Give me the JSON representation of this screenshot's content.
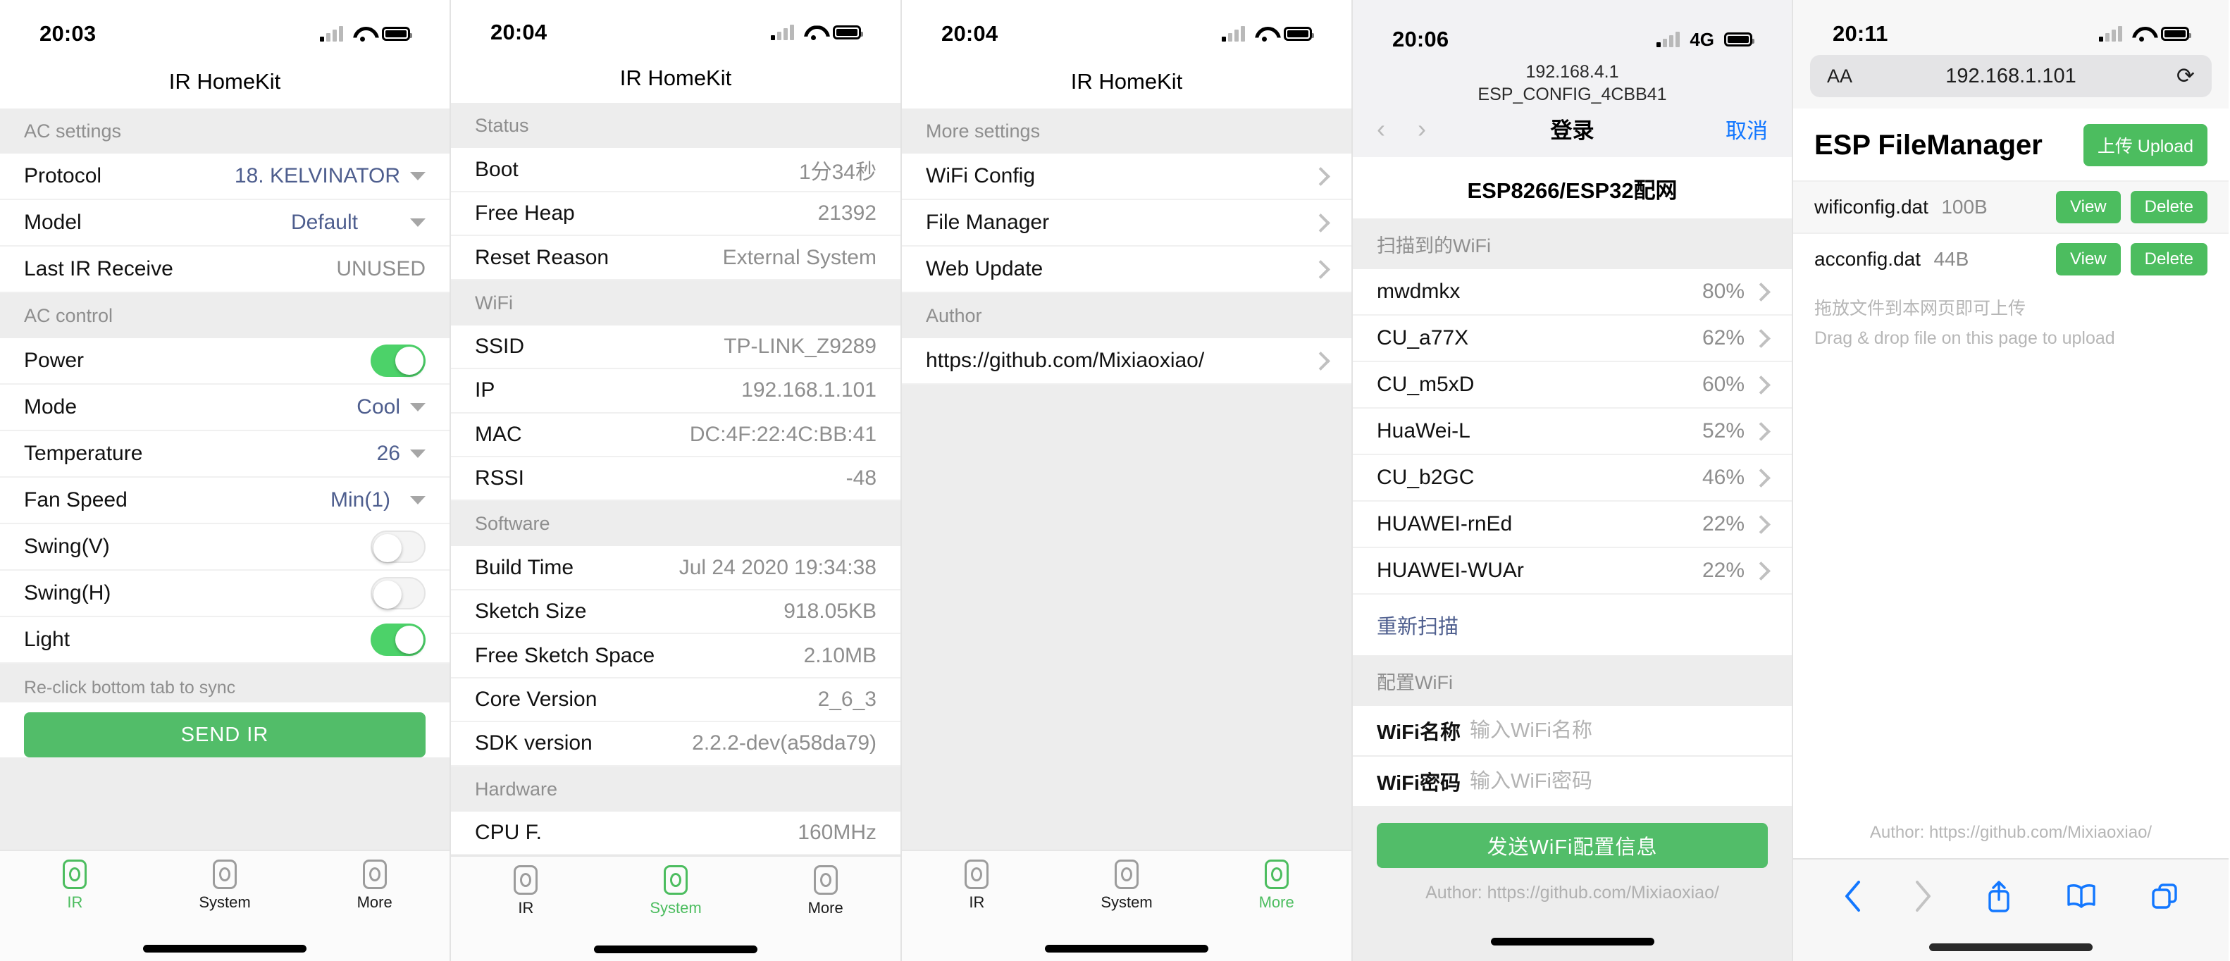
{
  "panel1": {
    "status": {
      "time": "20:03",
      "signal_icon": "cellular-bars-icon",
      "wifi_icon": "wifi-icon",
      "battery_icon": "battery-icon"
    },
    "nav_title": "IR HomeKit",
    "sections": [
      {
        "header": "AC settings",
        "rows": [
          {
            "label": "Protocol",
            "value": "18. KELVINATOR",
            "style": "blue",
            "control": "dropdown"
          },
          {
            "label": "Model",
            "value": "Default",
            "style": "blue",
            "control": "dropdown"
          },
          {
            "label": "Last IR Receive",
            "value": "UNUSED",
            "style": "gray",
            "control": "none"
          }
        ]
      },
      {
        "header": "AC control",
        "rows": [
          {
            "label": "Power",
            "value": "",
            "control": "toggle",
            "toggle_state": "on"
          },
          {
            "label": "Mode",
            "value": "Cool",
            "style": "blue",
            "control": "dropdown"
          },
          {
            "label": "Temperature",
            "value": "26",
            "style": "blue",
            "control": "dropdown"
          },
          {
            "label": "Fan Speed",
            "value": "Min(1)",
            "style": "blue",
            "control": "dropdown"
          },
          {
            "label": "Swing(V)",
            "value": "",
            "control": "toggle",
            "toggle_state": "off"
          },
          {
            "label": "Swing(H)",
            "value": "",
            "control": "toggle",
            "toggle_state": "off"
          },
          {
            "label": "Light",
            "value": "",
            "control": "toggle",
            "toggle_state": "on"
          }
        ]
      }
    ],
    "footer_note": "Re-click bottom tab to sync",
    "send_button": "SEND IR",
    "tabs": [
      {
        "label": "IR",
        "active": true
      },
      {
        "label": "System",
        "active": false
      },
      {
        "label": "More",
        "active": false
      }
    ]
  },
  "panel2": {
    "status": {
      "time": "20:04"
    },
    "nav_title": "IR HomeKit",
    "sections": [
      {
        "header": "Status",
        "rows": [
          {
            "label": "Boot",
            "value": "1分34秒"
          },
          {
            "label": "Free Heap",
            "value": "21392"
          },
          {
            "label": "Reset Reason",
            "value": "External System"
          }
        ]
      },
      {
        "header": "WiFi",
        "rows": [
          {
            "label": "SSID",
            "value": "TP-LINK_Z9289"
          },
          {
            "label": "IP",
            "value": "192.168.1.101"
          },
          {
            "label": "MAC",
            "value": "DC:4F:22:4C:BB:41"
          },
          {
            "label": "RSSI",
            "value": "-48"
          }
        ]
      },
      {
        "header": "Software",
        "rows": [
          {
            "label": "Build Time",
            "value": "Jul 24 2020 19:34:38"
          },
          {
            "label": "Sketch Size",
            "value": "918.05KB"
          },
          {
            "label": "Free Sketch Space",
            "value": "2.10MB"
          },
          {
            "label": "Core Version",
            "value": "2_6_3"
          },
          {
            "label": "SDK version",
            "value": "2.2.2-dev(a58da79)"
          }
        ]
      },
      {
        "header": "Hardware",
        "rows": [
          {
            "label": "CPU F.",
            "value": "160MHz"
          }
        ]
      }
    ],
    "tabs": [
      {
        "label": "IR",
        "active": false
      },
      {
        "label": "System",
        "active": true
      },
      {
        "label": "More",
        "active": false
      }
    ]
  },
  "panel3": {
    "status": {
      "time": "20:04"
    },
    "nav_title": "IR HomeKit",
    "sections": [
      {
        "header": "More settings",
        "rows": [
          {
            "label": "WiFi Config"
          },
          {
            "label": "File Manager"
          },
          {
            "label": "Web Update"
          }
        ]
      },
      {
        "header": "Author",
        "rows": [
          {
            "label": "https://github.com/Mixiaoxiao/"
          }
        ]
      }
    ],
    "tabs": [
      {
        "label": "IR",
        "active": false
      },
      {
        "label": "System",
        "active": false
      },
      {
        "label": "More",
        "active": true
      }
    ]
  },
  "panel4": {
    "status": {
      "time": "20:06",
      "network": "4G"
    },
    "url_line1": "192.168.4.1",
    "url_line2": "ESP_CONFIG_4CBB41",
    "back_icon": "chevron-left-icon",
    "forward_icon": "chevron-right-icon",
    "bar_title": "登录",
    "cancel": "取消",
    "page_title": "ESP8266/ESP32配网",
    "scan_header": "扫描到的WiFi",
    "networks": [
      {
        "ssid": "mwdmkx",
        "strength": "80%"
      },
      {
        "ssid": "CU_a77X",
        "strength": "62%"
      },
      {
        "ssid": "CU_m5xD",
        "strength": "60%"
      },
      {
        "ssid": "HuaWei-L",
        "strength": "52%"
      },
      {
        "ssid": "CU_b2GC",
        "strength": "46%"
      },
      {
        "ssid": "HUAWEI-rnEd",
        "strength": "22%"
      },
      {
        "ssid": "HUAWEI-WUAr",
        "strength": "22%"
      }
    ],
    "rescan": "重新扫描",
    "config_header": "配置WiFi",
    "fields": [
      {
        "label": "WiFi名称",
        "value": "",
        "placeholder": "输入WiFi名称"
      },
      {
        "label": "WiFi密码",
        "value": "",
        "placeholder": "输入WiFi密码"
      }
    ],
    "submit": "发送WiFi配置信息",
    "author": "Author: https://github.com/Mixiaoxiao/"
  },
  "panel5": {
    "status": {
      "time": "20:11"
    },
    "aa_label": "AA",
    "address": "192.168.1.101",
    "reload_icon": "reload-icon",
    "title": "ESP FileManager",
    "upload_button": "上传 Upload",
    "files": [
      {
        "name": "wificonfig.dat",
        "size": "100B",
        "view": "View",
        "delete": "Delete"
      },
      {
        "name": "acconfig.dat",
        "size": "44B",
        "view": "View",
        "delete": "Delete"
      }
    ],
    "hint_cn": "拖放文件到本网页即可上传",
    "hint_en": "Drag & drop file on this page to upload",
    "author": "Author: https://github.com/Mixiaoxiao/",
    "toolbar": [
      {
        "icon": "back-icon"
      },
      {
        "icon": "forward-icon"
      },
      {
        "icon": "share-icon"
      },
      {
        "icon": "bookmarks-icon"
      },
      {
        "icon": "tabs-icon"
      }
    ]
  },
  "colors": {
    "accent_green": "#4cbd5f",
    "toggle_on": "#4cd269",
    "link_blue": "#4e5e8e",
    "ios_blue": "#1277ff",
    "group_bg": "#ededed"
  }
}
